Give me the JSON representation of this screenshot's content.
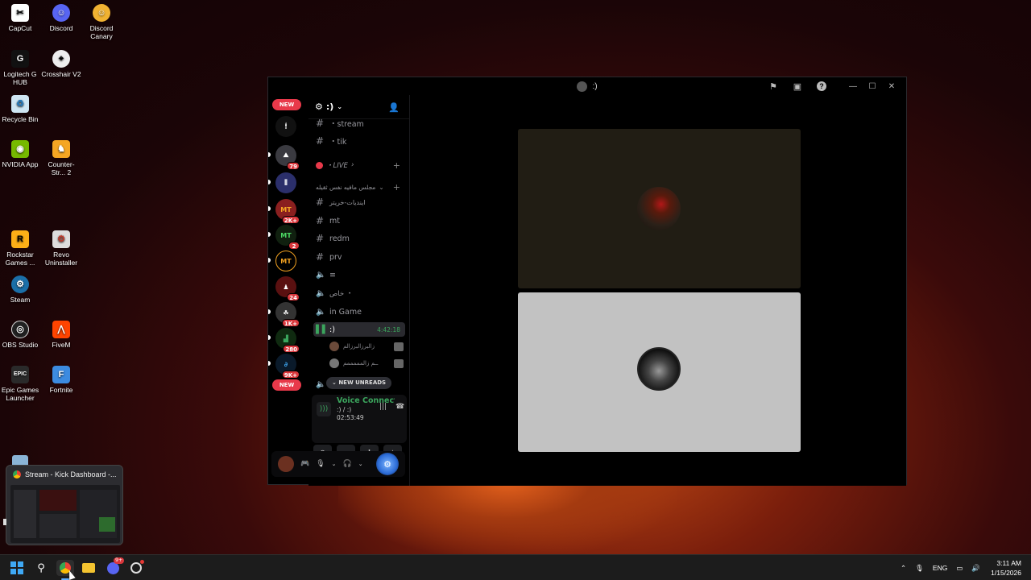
{
  "desktop": {
    "icons": [
      {
        "label": "CapCut"
      },
      {
        "label": "Discord"
      },
      {
        "label": "Discord Canary"
      },
      {
        "label": "Logitech G HUB"
      },
      {
        "label": "Crosshair V2"
      },
      {
        "label": "Recycle Bin"
      },
      {
        "label": "NVIDIA App"
      },
      {
        "label": "Counter-Str... 2"
      },
      {
        "label": "Rockstar Games ..."
      },
      {
        "label": "Revo Uninstaller"
      },
      {
        "label": "Steam"
      },
      {
        "label": "OBS Studio"
      },
      {
        "label": "FiveM"
      },
      {
        "label": "Epic Games Launcher"
      },
      {
        "label": "Fortnite"
      }
    ]
  },
  "discord": {
    "window_title": ":)",
    "rail": {
      "new_top": "NEW",
      "new_bottom": "NEW",
      "badges": [
        "79",
        "2K+",
        "2",
        "24",
        "1K+",
        "280",
        "9K+"
      ]
    },
    "server_name": ":)",
    "channels": {
      "stream": "・stream",
      "tik": "・tik",
      "live_category": "・LIVE",
      "arabic_category": "مجلس مافيه نفس ثقيله",
      "arabic_channel": "اينديات-خريتر",
      "mt": "mt",
      "redm": "redm",
      "prv": "prv",
      "icon_channel": "≡",
      "khas": "خاص ・",
      "in_game": "in Game",
      "voice_active": ":)",
      "voice_timer": "4:42:18"
    },
    "voice_users": [
      "زالبرزالبرزالم",
      "ــم زالمممممم"
    ],
    "new_unreads": "NEW UNREADS",
    "voice_panel": {
      "status": "Voice Connected",
      "channel": ":) / :)",
      "elapsed": "02:53:49"
    }
  },
  "preview": {
    "title": "Stream - Kick Dashboard -..."
  },
  "taskbar": {
    "lang": "ENG",
    "time": "3:11 AM",
    "date": "1/15/2026",
    "discord_badge": "9+"
  },
  "colors": {
    "accent_green": "#3ba55d",
    "badge_red": "#da373c",
    "tile_top": "#211d14",
    "tile_bottom": "#c2c2c2"
  }
}
